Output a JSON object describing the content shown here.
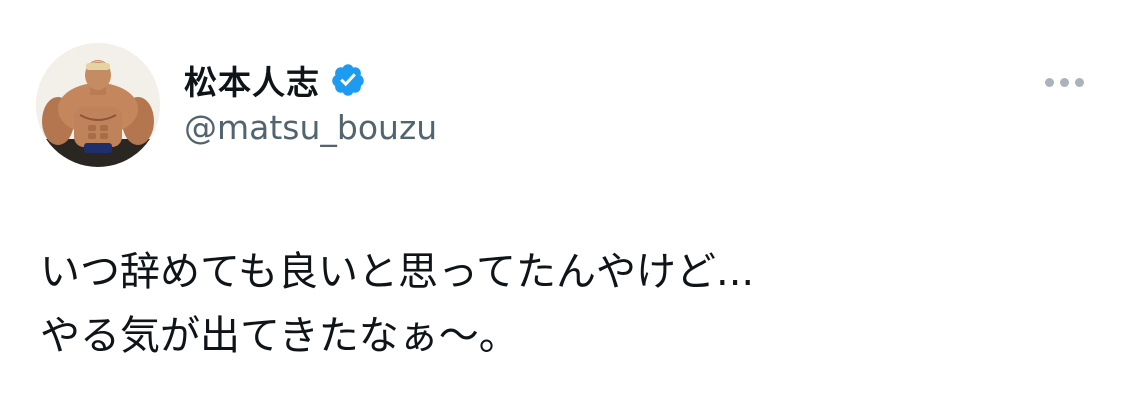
{
  "author": {
    "display_name": "松本人志",
    "handle": "@matsu_bouzu",
    "verified": true,
    "avatar_icon": "bodybuilder-figure-avatar"
  },
  "icons": {
    "verified": "verified-badge-icon",
    "more": "more-options-icon"
  },
  "tweet": {
    "lines": [
      "いつ辞めても良いと思ってたんやけど...",
      "やる気が出てきたなぁ〜。"
    ]
  },
  "colors": {
    "text": "#0f1419",
    "secondary_text": "#536471",
    "verified_blue": "#1d9bf0",
    "more_dots": "#aab3bb",
    "background": "#ffffff"
  }
}
